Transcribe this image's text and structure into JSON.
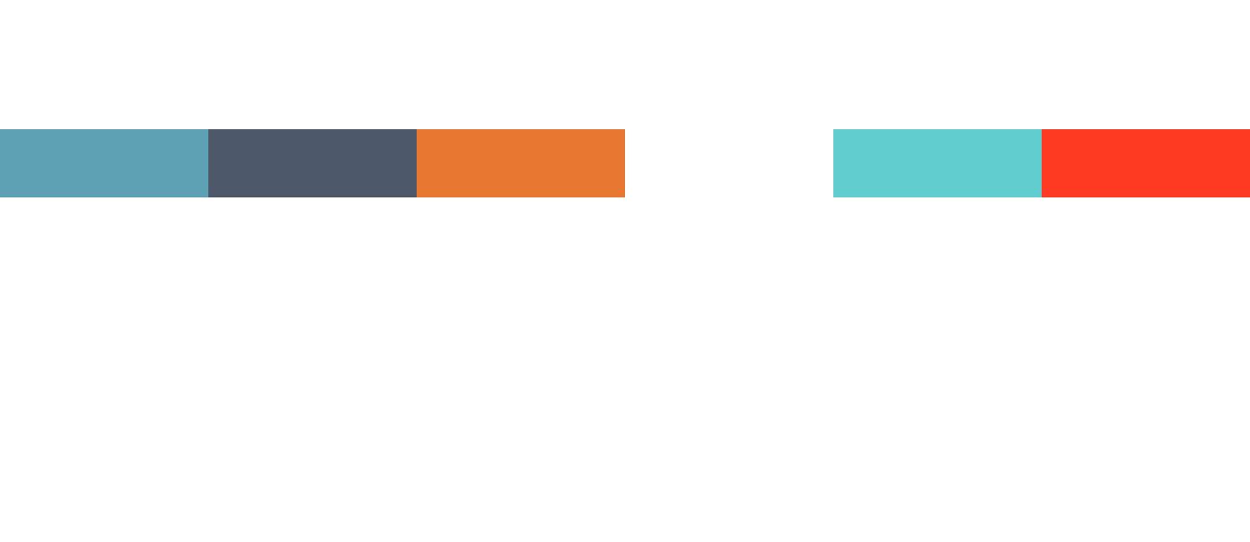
{
  "palette": {
    "swatches": [
      {
        "color": "#5fa1b4"
      },
      {
        "color": "#4e586b"
      },
      {
        "color": "#e87731"
      },
      {
        "color": "#ffffff"
      },
      {
        "color": "#62cdcf"
      },
      {
        "color": "#ff3a22"
      }
    ]
  }
}
